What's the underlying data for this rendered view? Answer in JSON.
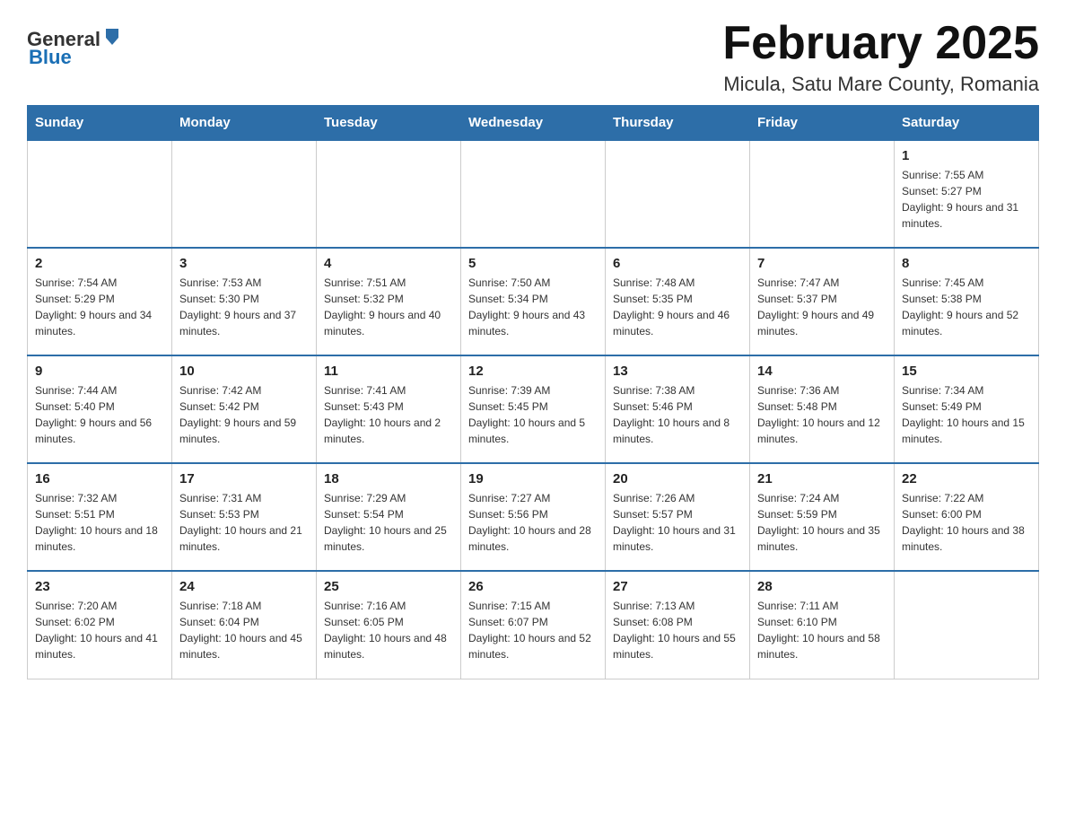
{
  "header": {
    "logo_general": "General",
    "logo_blue": "Blue",
    "month_year": "February 2025",
    "location": "Micula, Satu Mare County, Romania"
  },
  "days_of_week": [
    "Sunday",
    "Monday",
    "Tuesday",
    "Wednesday",
    "Thursday",
    "Friday",
    "Saturday"
  ],
  "weeks": [
    [
      {
        "day": "",
        "info": ""
      },
      {
        "day": "",
        "info": ""
      },
      {
        "day": "",
        "info": ""
      },
      {
        "day": "",
        "info": ""
      },
      {
        "day": "",
        "info": ""
      },
      {
        "day": "",
        "info": ""
      },
      {
        "day": "1",
        "info": "Sunrise: 7:55 AM\nSunset: 5:27 PM\nDaylight: 9 hours and 31 minutes."
      }
    ],
    [
      {
        "day": "2",
        "info": "Sunrise: 7:54 AM\nSunset: 5:29 PM\nDaylight: 9 hours and 34 minutes."
      },
      {
        "day": "3",
        "info": "Sunrise: 7:53 AM\nSunset: 5:30 PM\nDaylight: 9 hours and 37 minutes."
      },
      {
        "day": "4",
        "info": "Sunrise: 7:51 AM\nSunset: 5:32 PM\nDaylight: 9 hours and 40 minutes."
      },
      {
        "day": "5",
        "info": "Sunrise: 7:50 AM\nSunset: 5:34 PM\nDaylight: 9 hours and 43 minutes."
      },
      {
        "day": "6",
        "info": "Sunrise: 7:48 AM\nSunset: 5:35 PM\nDaylight: 9 hours and 46 minutes."
      },
      {
        "day": "7",
        "info": "Sunrise: 7:47 AM\nSunset: 5:37 PM\nDaylight: 9 hours and 49 minutes."
      },
      {
        "day": "8",
        "info": "Sunrise: 7:45 AM\nSunset: 5:38 PM\nDaylight: 9 hours and 52 minutes."
      }
    ],
    [
      {
        "day": "9",
        "info": "Sunrise: 7:44 AM\nSunset: 5:40 PM\nDaylight: 9 hours and 56 minutes."
      },
      {
        "day": "10",
        "info": "Sunrise: 7:42 AM\nSunset: 5:42 PM\nDaylight: 9 hours and 59 minutes."
      },
      {
        "day": "11",
        "info": "Sunrise: 7:41 AM\nSunset: 5:43 PM\nDaylight: 10 hours and 2 minutes."
      },
      {
        "day": "12",
        "info": "Sunrise: 7:39 AM\nSunset: 5:45 PM\nDaylight: 10 hours and 5 minutes."
      },
      {
        "day": "13",
        "info": "Sunrise: 7:38 AM\nSunset: 5:46 PM\nDaylight: 10 hours and 8 minutes."
      },
      {
        "day": "14",
        "info": "Sunrise: 7:36 AM\nSunset: 5:48 PM\nDaylight: 10 hours and 12 minutes."
      },
      {
        "day": "15",
        "info": "Sunrise: 7:34 AM\nSunset: 5:49 PM\nDaylight: 10 hours and 15 minutes."
      }
    ],
    [
      {
        "day": "16",
        "info": "Sunrise: 7:32 AM\nSunset: 5:51 PM\nDaylight: 10 hours and 18 minutes."
      },
      {
        "day": "17",
        "info": "Sunrise: 7:31 AM\nSunset: 5:53 PM\nDaylight: 10 hours and 21 minutes."
      },
      {
        "day": "18",
        "info": "Sunrise: 7:29 AM\nSunset: 5:54 PM\nDaylight: 10 hours and 25 minutes."
      },
      {
        "day": "19",
        "info": "Sunrise: 7:27 AM\nSunset: 5:56 PM\nDaylight: 10 hours and 28 minutes."
      },
      {
        "day": "20",
        "info": "Sunrise: 7:26 AM\nSunset: 5:57 PM\nDaylight: 10 hours and 31 minutes."
      },
      {
        "day": "21",
        "info": "Sunrise: 7:24 AM\nSunset: 5:59 PM\nDaylight: 10 hours and 35 minutes."
      },
      {
        "day": "22",
        "info": "Sunrise: 7:22 AM\nSunset: 6:00 PM\nDaylight: 10 hours and 38 minutes."
      }
    ],
    [
      {
        "day": "23",
        "info": "Sunrise: 7:20 AM\nSunset: 6:02 PM\nDaylight: 10 hours and 41 minutes."
      },
      {
        "day": "24",
        "info": "Sunrise: 7:18 AM\nSunset: 6:04 PM\nDaylight: 10 hours and 45 minutes."
      },
      {
        "day": "25",
        "info": "Sunrise: 7:16 AM\nSunset: 6:05 PM\nDaylight: 10 hours and 48 minutes."
      },
      {
        "day": "26",
        "info": "Sunrise: 7:15 AM\nSunset: 6:07 PM\nDaylight: 10 hours and 52 minutes."
      },
      {
        "day": "27",
        "info": "Sunrise: 7:13 AM\nSunset: 6:08 PM\nDaylight: 10 hours and 55 minutes."
      },
      {
        "day": "28",
        "info": "Sunrise: 7:11 AM\nSunset: 6:10 PM\nDaylight: 10 hours and 58 minutes."
      },
      {
        "day": "",
        "info": ""
      }
    ]
  ]
}
